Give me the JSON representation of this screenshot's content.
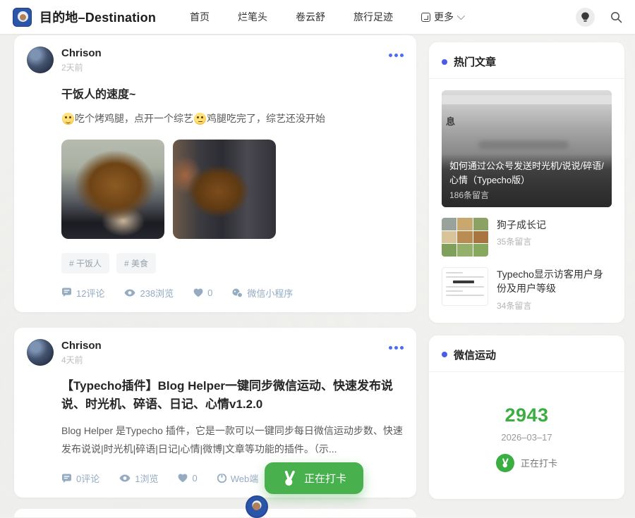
{
  "colors": {
    "accent_blue": "#4a6cf6",
    "widget_dot_blue": "#4a5be8",
    "green": "#48b14e",
    "stat_gray_blue": "#95abc2"
  },
  "header": {
    "site_title": "目的地–Destination",
    "nav": [
      {
        "label": "首页"
      },
      {
        "label": "烂笔头"
      },
      {
        "label": "卷云舒"
      },
      {
        "label": "旅行足迹"
      },
      {
        "label": "更多"
      }
    ]
  },
  "posts": [
    {
      "author": "Chrison",
      "time": "2天前",
      "title": "干饭人的速度~",
      "body_parts": {
        "text1": "吃个烤鸡腿，点开一个综艺",
        "text2": "鸡腿吃完了，综艺还没开始"
      },
      "tags": [
        "# 干饭人",
        "# 美食"
      ],
      "stats": [
        {
          "icon": "comment",
          "label": "12评论"
        },
        {
          "icon": "eye",
          "label": "238浏览"
        },
        {
          "icon": "heart",
          "label": "0"
        },
        {
          "icon": "wechat-mini-program",
          "label": "微信小程序"
        }
      ]
    },
    {
      "author": "Chrison",
      "time": "4天前",
      "title": "【Typecho插件】Blog Helper一键同步微信运动、快速发布说说、时光机、碎语、日记、心情v1.2.0",
      "excerpt": "Blog Helper 是Typecho 插件，它是一款可以一键同步每日微信运动步数、快速发布说说|时光机|碎语|日记|心情|微博|文章等功能的插件。（示...",
      "stats": [
        {
          "icon": "comment",
          "label": "0评论"
        },
        {
          "icon": "eye",
          "label": "1浏览"
        },
        {
          "icon": "heart",
          "label": "0"
        },
        {
          "icon": "web",
          "label": "Web端"
        }
      ]
    }
  ],
  "sidebar": {
    "hot_articles": {
      "title": "热门文章",
      "featured": {
        "bg_text": "息",
        "title": "如何通过公众号发送时光机/说说/碎语/心情（Typecho版）",
        "comments": "186条留言"
      },
      "items": [
        {
          "title": "狗子成长记",
          "comments": "35条留言"
        },
        {
          "title": "Typecho显示访客用户身份及用户等级",
          "comments": "34条留言"
        }
      ]
    },
    "wechat_sport": {
      "title": "微信运动",
      "steps": "2943",
      "date": "2026–03–17",
      "status": "正在打卡"
    }
  },
  "floating_button": {
    "label": "正在打卡"
  }
}
